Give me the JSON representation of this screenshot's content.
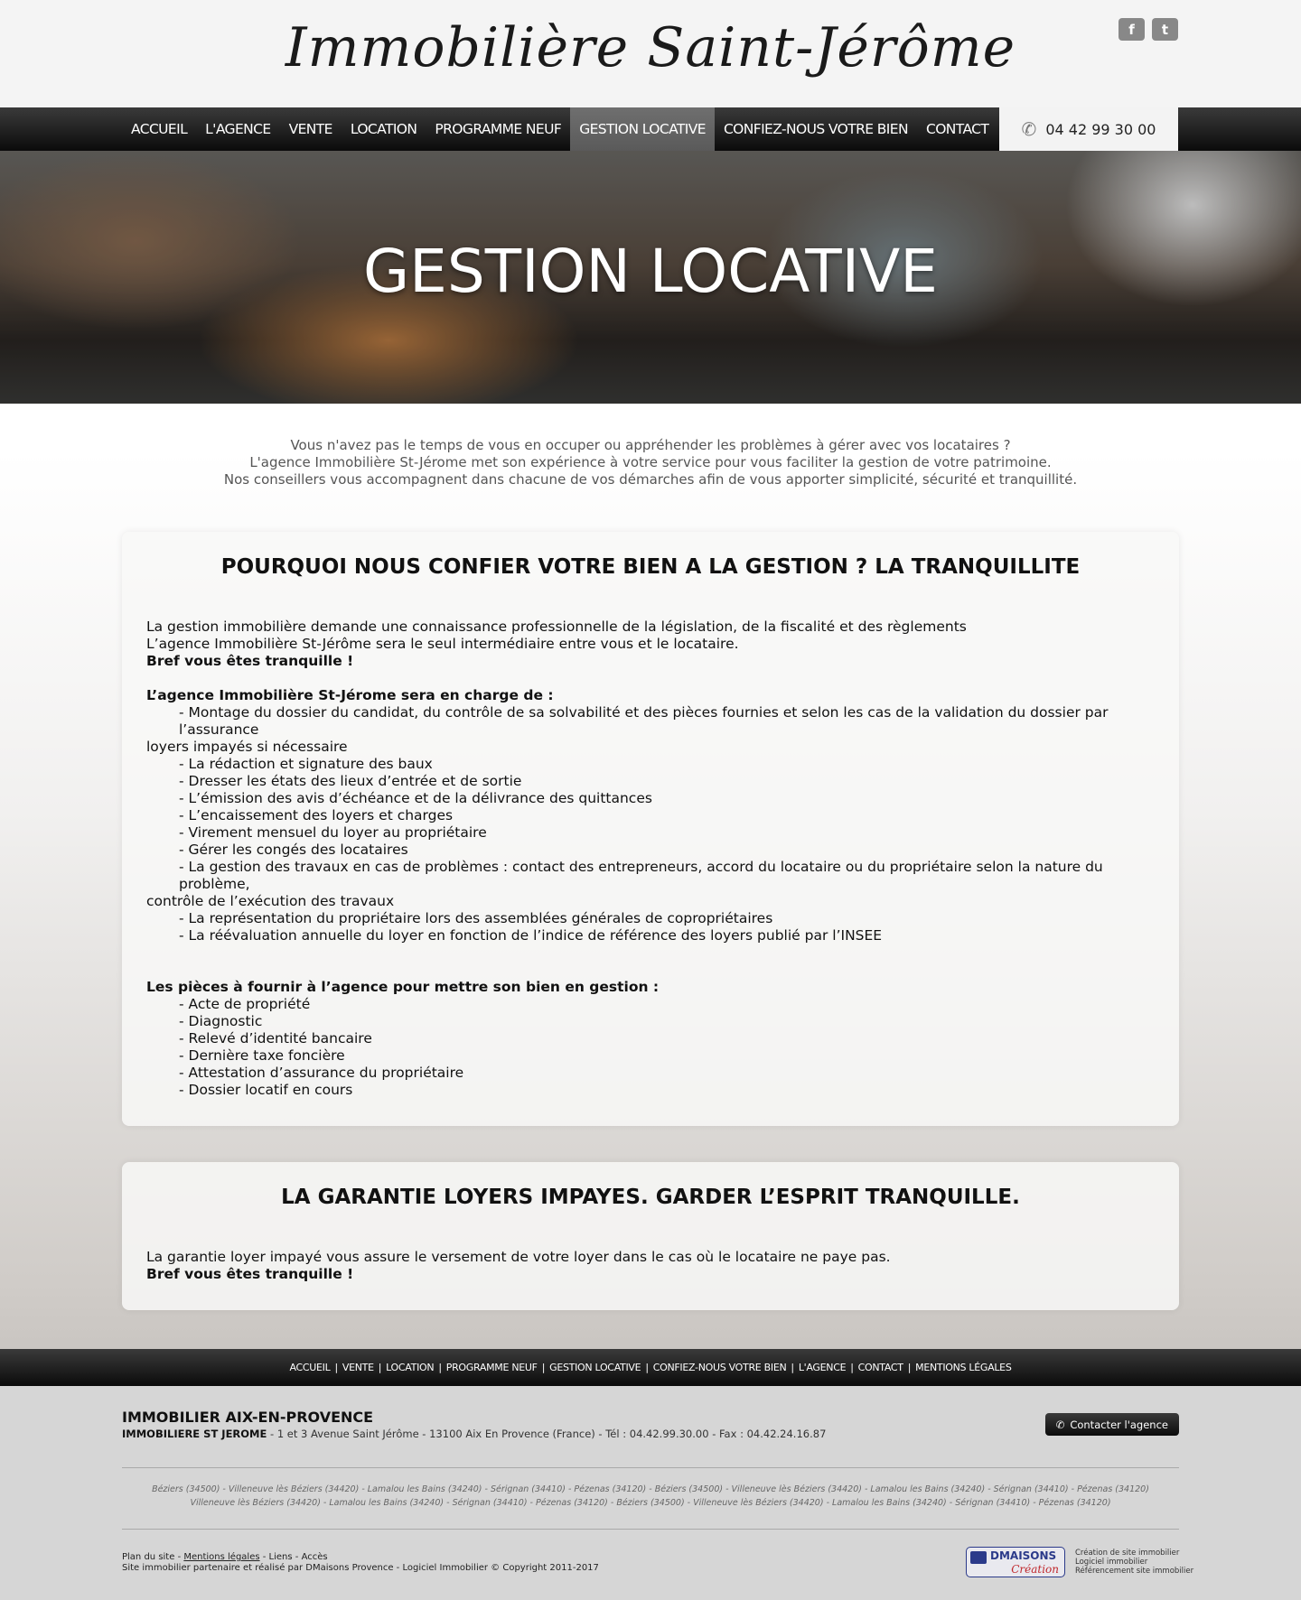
{
  "header": {
    "logo": "Immobilière Saint-Jérôme",
    "social": [
      "f",
      "t"
    ],
    "phone": "04 42 99 30 00"
  },
  "nav": {
    "items": [
      "ACCUEIL",
      "L'AGENCE",
      "VENTE",
      "LOCATION",
      "PROGRAMME NEUF",
      "GESTION LOCATIVE",
      "CONFIEZ-NOUS VOTRE BIEN",
      "CONTACT"
    ],
    "active": "GESTION LOCATIVE"
  },
  "hero": {
    "title": "GESTION LOCATIVE"
  },
  "intro": [
    "Vous n'avez pas le temps de vous en occuper ou appréhender les problèmes à gérer avec vos locataires ?",
    "L'agence Immobilière St-Jérome met son expérience à votre service pour vous faciliter la gestion de votre patrimoine.",
    "Nos conseillers vous accompagnent dans chacune de vos démarches afin de vous apporter simplicité, sécurité et tranquillité."
  ],
  "card1": {
    "title": "POURQUOI NOUS CONFIER VOTRE BIEN A LA GESTION ? LA TRANQUILLITE",
    "p1": "La gestion immobilière demande une connaissance professionnelle de la législation, de la fiscalité et des règlements",
    "p2": "L’agence Immobilière St-Jérôme sera le seul intermédiaire entre vous et le locataire.",
    "p3": "Bref vous êtes tranquille !",
    "charge_heading": "L’agence Immobilière St-Jérome sera en charge de :",
    "charge_items": [
      "- Montage du dossier du candidat, du contrôle de sa solvabilité et des pièces fournies et selon les cas de la validation du dossier par l’assurance",
      "- La rédaction et signature des baux",
      "- Dresser les états des lieux d’entrée et de sortie",
      "- L’émission des avis d’échéance et de la délivrance des quittances",
      "- L’encaissement des loyers et charges",
      "- Virement mensuel du loyer au propriétaire",
      "- Gérer les congés des locataires",
      "- La gestion des travaux en cas de problèmes : contact des entrepreneurs, accord du locataire ou du propriétaire selon la nature du problème,",
      "- La représentation du propriétaire lors des assemblées générales de copropriétaires",
      "- La réévaluation annuelle du loyer en fonction de l’indice de référence des loyers publié par l’INSEE"
    ],
    "charge_cont_1": "loyers impayés si nécessaire",
    "charge_cont_8": "contrôle de l’exécution des travaux",
    "pieces_heading": "Les pièces à fournir à l’agence pour mettre son bien en gestion :",
    "pieces_items": [
      "- Acte de propriété",
      "- Diagnostic",
      "- Relevé d’identité bancaire",
      "- Dernière taxe foncière",
      "- Attestation d’assurance du propriétaire",
      "- Dossier locatif en cours"
    ]
  },
  "card2": {
    "title": "LA GARANTIE LOYERS IMPAYES. GARDER L’ESPRIT TRANQUILLE.",
    "p1": "La garantie loyer impayé vous assure le versement de votre loyer dans le cas où le locataire ne paye pas.",
    "p2": "Bref vous êtes tranquille !"
  },
  "footer_nav": [
    "ACCUEIL",
    "VENTE",
    "LOCATION",
    "PROGRAMME NEUF",
    "GESTION LOCATIVE",
    "CONFIEZ-NOUS VOTRE BIEN",
    "L'AGENCE",
    "CONTACT",
    "MENTIONS LÉGALES"
  ],
  "footer": {
    "title": "IMMOBILIER AIX-EN-PROVENCE",
    "agency": "IMMOBILIERE ST JEROME",
    "address": " - 1 et 3 Avenue Saint Jérôme - 13100 Aix En Provence (France) - Tél : 04.42.99.30.00 - Fax : 04.42.24.16.87",
    "contact_button": "Contacter l'agence",
    "cities_1": "Béziers (34500) - Villeneuve lès Béziers (34420) - Lamalou les Bains (34240) - Sérignan (34410) - Pézenas (34120) - Béziers (34500) - Villeneuve lès Béziers (34420) - Lamalou les Bains (34240) - Sérignan (34410) - Pézenas (34120)",
    "cities_2": "Villeneuve lès Béziers (34420) - Lamalou les Bains (34240) - Sérignan (34410) - Pézenas (34120) - Béziers (34500) - Villeneuve lès Béziers (34420) - Lamalou les Bains (34240) - Sérignan (34410) - Pézenas (34120)",
    "links": [
      "Plan du site",
      "Mentions légales",
      "Liens",
      "Accès"
    ],
    "credit": "Site immobilier partenaire et réalisé par DMaisons Provence - Logiciel Immobilier © Copyright 2011-2017",
    "dm_brand": "DMAISONS",
    "dm_sub": "Création",
    "dm_lines": [
      "Création de site immobilier",
      "Logiciel immobilier",
      "Référencement site immobilier"
    ]
  }
}
